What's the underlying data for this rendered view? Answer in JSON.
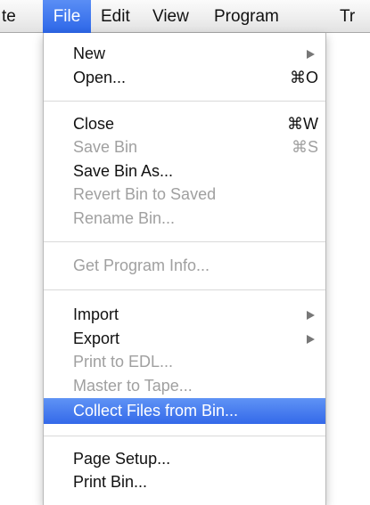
{
  "menubar": {
    "items": [
      {
        "label": "te"
      },
      {
        "label": "File"
      },
      {
        "label": "Edit"
      },
      {
        "label": "View"
      },
      {
        "label": "Program"
      },
      {
        "label": "Tr"
      }
    ]
  },
  "file_menu": {
    "new": {
      "label": "New"
    },
    "open": {
      "label": "Open...",
      "shortcut": "⌘O"
    },
    "close": {
      "label": "Close",
      "shortcut": "⌘W"
    },
    "save_bin": {
      "label": "Save Bin",
      "shortcut": "⌘S"
    },
    "save_bin_as": {
      "label": "Save Bin As..."
    },
    "revert_bin": {
      "label": "Revert Bin to Saved"
    },
    "rename_bin": {
      "label": "Rename Bin..."
    },
    "get_program_info": {
      "label": "Get Program Info..."
    },
    "import": {
      "label": "Import"
    },
    "export": {
      "label": "Export"
    },
    "print_to_edl": {
      "label": "Print to EDL..."
    },
    "master_to_tape": {
      "label": "Master to Tape..."
    },
    "collect_files": {
      "label": "Collect Files from Bin..."
    },
    "page_setup": {
      "label": "Page Setup..."
    },
    "print_bin": {
      "label": "Print Bin..."
    }
  },
  "colors": {
    "highlight": "#3469e9",
    "disabled_text": "#a0a0a0"
  }
}
